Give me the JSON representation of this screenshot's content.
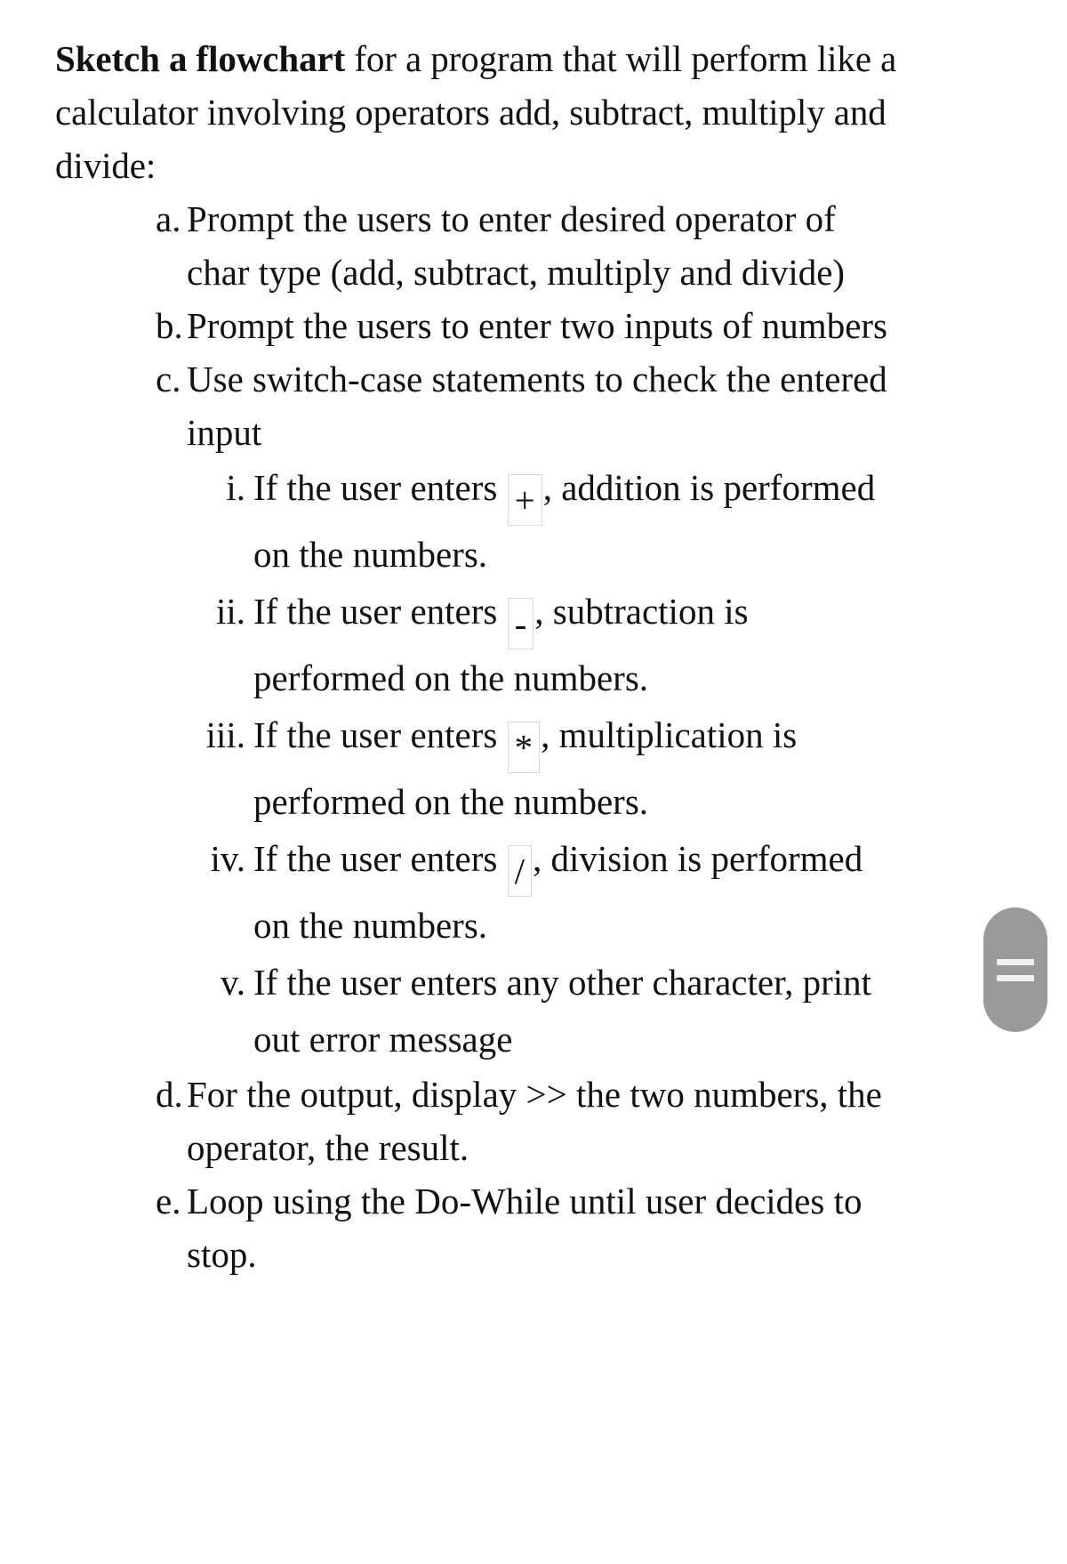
{
  "document": {
    "intro": {
      "bold_lead": "Sketch a flowchart",
      "rest": " for a program that will perform like a calculator involving operators add, subtract, multiply and divide:"
    },
    "items": [
      {
        "marker": "a.",
        "text": "Prompt the users to enter desired operator of char type (add, subtract, multiply and divide)"
      },
      {
        "marker": "b.",
        "text": "Prompt the users to enter two inputs of numbers"
      },
      {
        "marker": "c.",
        "text": "Use switch-case statements to check the entered input",
        "subitems": [
          {
            "marker": "i.",
            "prefix": "If the user enters ",
            "operator": "+",
            "suffix": ", addition is performed on the numbers."
          },
          {
            "marker": "ii.",
            "prefix": "If the user enters ",
            "operator": "-",
            "suffix": ", subtraction is performed on the numbers."
          },
          {
            "marker": "iii.",
            "prefix": "If the user enters ",
            "operator": "*",
            "suffix": ", multiplication is performed on the numbers."
          },
          {
            "marker": "iv.",
            "prefix": "If the user enters ",
            "operator": "/",
            "suffix": ", division is performed on the numbers."
          },
          {
            "marker": "v.",
            "prefix": "If the user enters any other character, print out error message",
            "operator": "",
            "suffix": ""
          }
        ]
      },
      {
        "marker": "d.",
        "text": "For the output, display >> the two numbers, the operator, the result."
      },
      {
        "marker": "e.",
        "text": "Loop using the Do-While until user decides to stop."
      }
    ]
  },
  "scrollbar": {
    "handle_color": "#9a9a9a",
    "grip_color": "#f0f0f0"
  }
}
